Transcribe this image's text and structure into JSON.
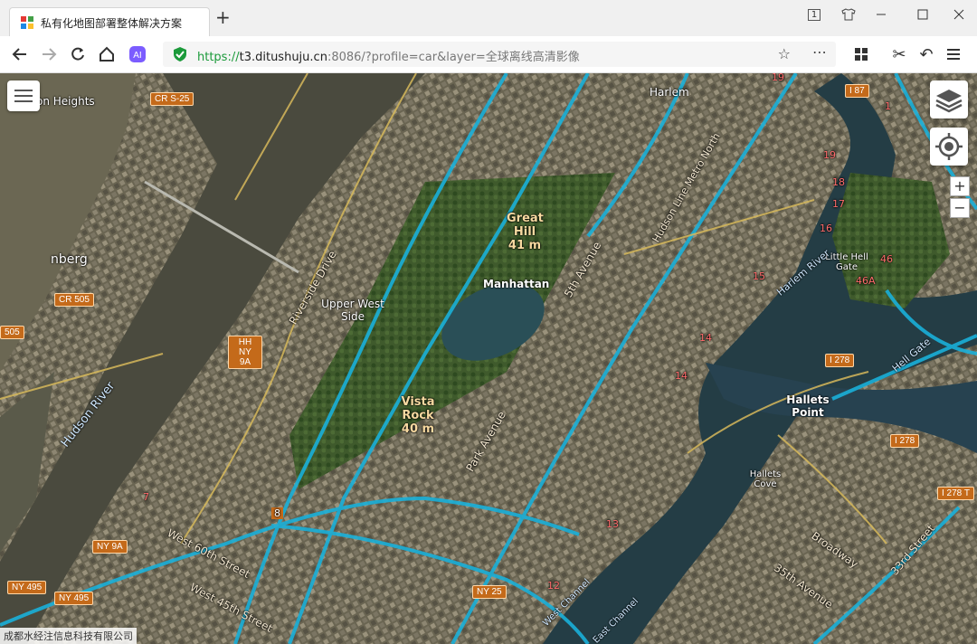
{
  "browser": {
    "tab_title": "私有化地图部署整体解决方案",
    "url_protocol": "https://",
    "url_host": "t3.ditushuju.cn",
    "url_rest": ":8086/?profile=car&layer=全球离线高清影像",
    "window_badge": "1"
  },
  "map": {
    "places": [
      {
        "text": "Harlem"
      },
      {
        "text": "Manhattan"
      },
      {
        "text": "Upper West Side"
      },
      {
        "text": "Hallets Point"
      },
      {
        "text": "Little Hell Gate"
      },
      {
        "text": "Hallets Cove"
      },
      {
        "text": "nberg"
      },
      {
        "text": "on Heights"
      }
    ],
    "poi": [
      {
        "text": "Great Hill 41 m"
      },
      {
        "text": "Vista Rock 40 m"
      }
    ],
    "water": [
      {
        "text": "Hudson River"
      },
      {
        "text": "Harlem River"
      },
      {
        "text": "Hell Gate"
      },
      {
        "text": "West Channel"
      },
      {
        "text": "East Channel"
      }
    ],
    "streets": [
      {
        "text": "Riverside Drive"
      },
      {
        "text": "5th Avenue"
      },
      {
        "text": "Park Avenue"
      },
      {
        "text": "Hudson Line Metro North"
      },
      {
        "text": "West 60th Street"
      },
      {
        "text": "West 45th Street"
      },
      {
        "text": "Broadway"
      },
      {
        "text": "35th Avenue"
      },
      {
        "text": "33rd Street"
      }
    ],
    "shields": [
      "CR S-25",
      "CR 505",
      "505",
      "HH NY 9A",
      "NY 9A",
      "NY 495",
      "NY 495",
      "NY 25",
      "I 87",
      "I 278",
      "I 278",
      "I 278 T"
    ],
    "exits": [
      "19",
      "19",
      "18",
      "17",
      "16",
      "15",
      "14",
      "14",
      "13",
      "12",
      "46",
      "46A",
      "7",
      "8",
      "1"
    ],
    "attribution": "成都水经注信息科技有限公司"
  }
}
